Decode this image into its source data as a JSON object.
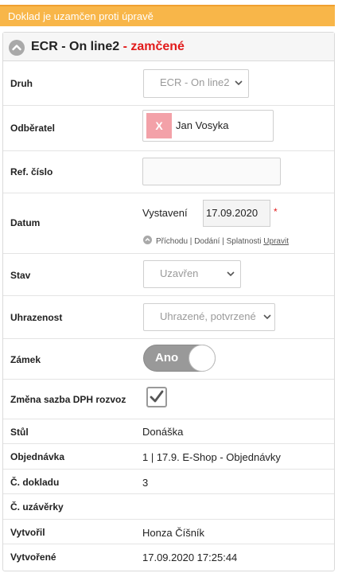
{
  "banner": "Doklad je uzamčen proti úpravě",
  "panel": {
    "title": "ECR - On line2",
    "title_suffix": " - zamčené"
  },
  "fields": {
    "druh": {
      "label": "Druh",
      "value": "ECR - On line2"
    },
    "odberatel": {
      "label": "Odběratel",
      "badge": "X",
      "name": "Jan Vosyka"
    },
    "ref": {
      "label": "Ref. číslo",
      "value": ""
    },
    "datum": {
      "label": "Datum",
      "sublabel": "Vystavení",
      "value": "17.09.2020",
      "required_mark": "*",
      "links": {
        "prichodu": "Příchodu",
        "sep1": " | ",
        "dodani": "Dodání",
        "sep2": " | ",
        "splatnosti": "Splatnosti",
        "upravit": "Upravit"
      }
    },
    "stav": {
      "label": "Stav",
      "value": "Uzavřen"
    },
    "uhrazenost": {
      "label": "Uhrazenost",
      "value": "Uhrazené, potvrzené"
    },
    "zamek": {
      "label": "Zámek",
      "value": "Ano",
      "on": true
    },
    "dph": {
      "label": "Změna sazba DPH rozvoz",
      "checked": true
    },
    "stul": {
      "label": "Stůl",
      "value": "Donáška"
    },
    "objednavka": {
      "label": "Objednávka",
      "value": "1 | 17.9. E-Shop - Objednávky"
    },
    "cislo_dokladu": {
      "label": "Č. dokladu",
      "value": "3"
    },
    "cislo_uzaverky": {
      "label": "Č. uzávěrky",
      "value": ""
    },
    "vytvoril": {
      "label": "Vytvořil",
      "value": "Honza Číšník"
    },
    "vytvorene": {
      "label": "Vytvořené",
      "value": "17.09.2020 17:25:44"
    }
  }
}
